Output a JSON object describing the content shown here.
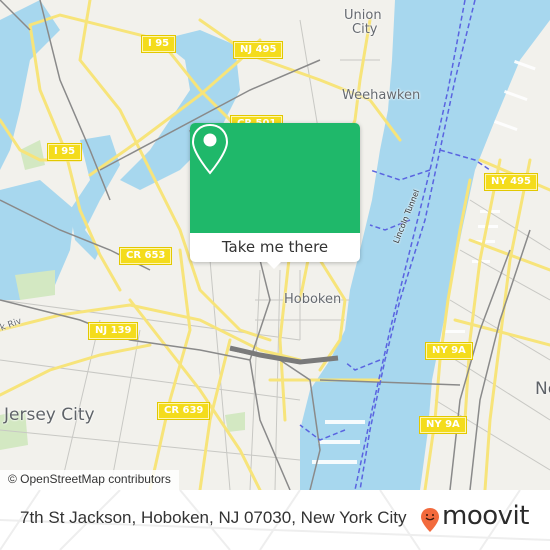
{
  "map": {
    "colors": {
      "land": "#f2f1ec",
      "water": "#a7d7ee",
      "park": "#d3e8c2",
      "major_road": "#f7e47a",
      "minor_road": "#c8c8c4",
      "rail": "#8a8a8a",
      "ferry": "#5a64e0",
      "shield": "#f4dc1c"
    },
    "road_shields": [
      {
        "id": "i95-north",
        "label": "I 95"
      },
      {
        "id": "nj495",
        "label": "NJ 495"
      },
      {
        "id": "cr501",
        "label": "CR 501"
      },
      {
        "id": "i95-south",
        "label": "I 95"
      },
      {
        "id": "ny495",
        "label": "NY 495"
      },
      {
        "id": "cr653",
        "label": "CR 653"
      },
      {
        "id": "nj139",
        "label": "NJ 139"
      },
      {
        "id": "ny9a-north",
        "label": "NY 9A"
      },
      {
        "id": "cr639",
        "label": "CR 639"
      },
      {
        "id": "ny9a-south",
        "label": "NY 9A"
      }
    ],
    "place_labels": {
      "union_city_line1": "Union",
      "union_city_line2": "City",
      "weehawken": "Weehawken",
      "hoboken": "Hoboken",
      "jersey_city": "Jersey City",
      "new_york": "Ne",
      "river": "k Riv",
      "tunnel": "Lincoln Tunnel"
    },
    "attribution": "© OpenStreetMap contributors"
  },
  "popup": {
    "background": "#1fb86a",
    "icon": "map-pin-icon",
    "button_label": "Take me there"
  },
  "footer": {
    "address": "7th St Jackson, Hoboken, NJ 07030, New York City",
    "logo_text": "moovit",
    "logo_color": "#f26a3d"
  }
}
